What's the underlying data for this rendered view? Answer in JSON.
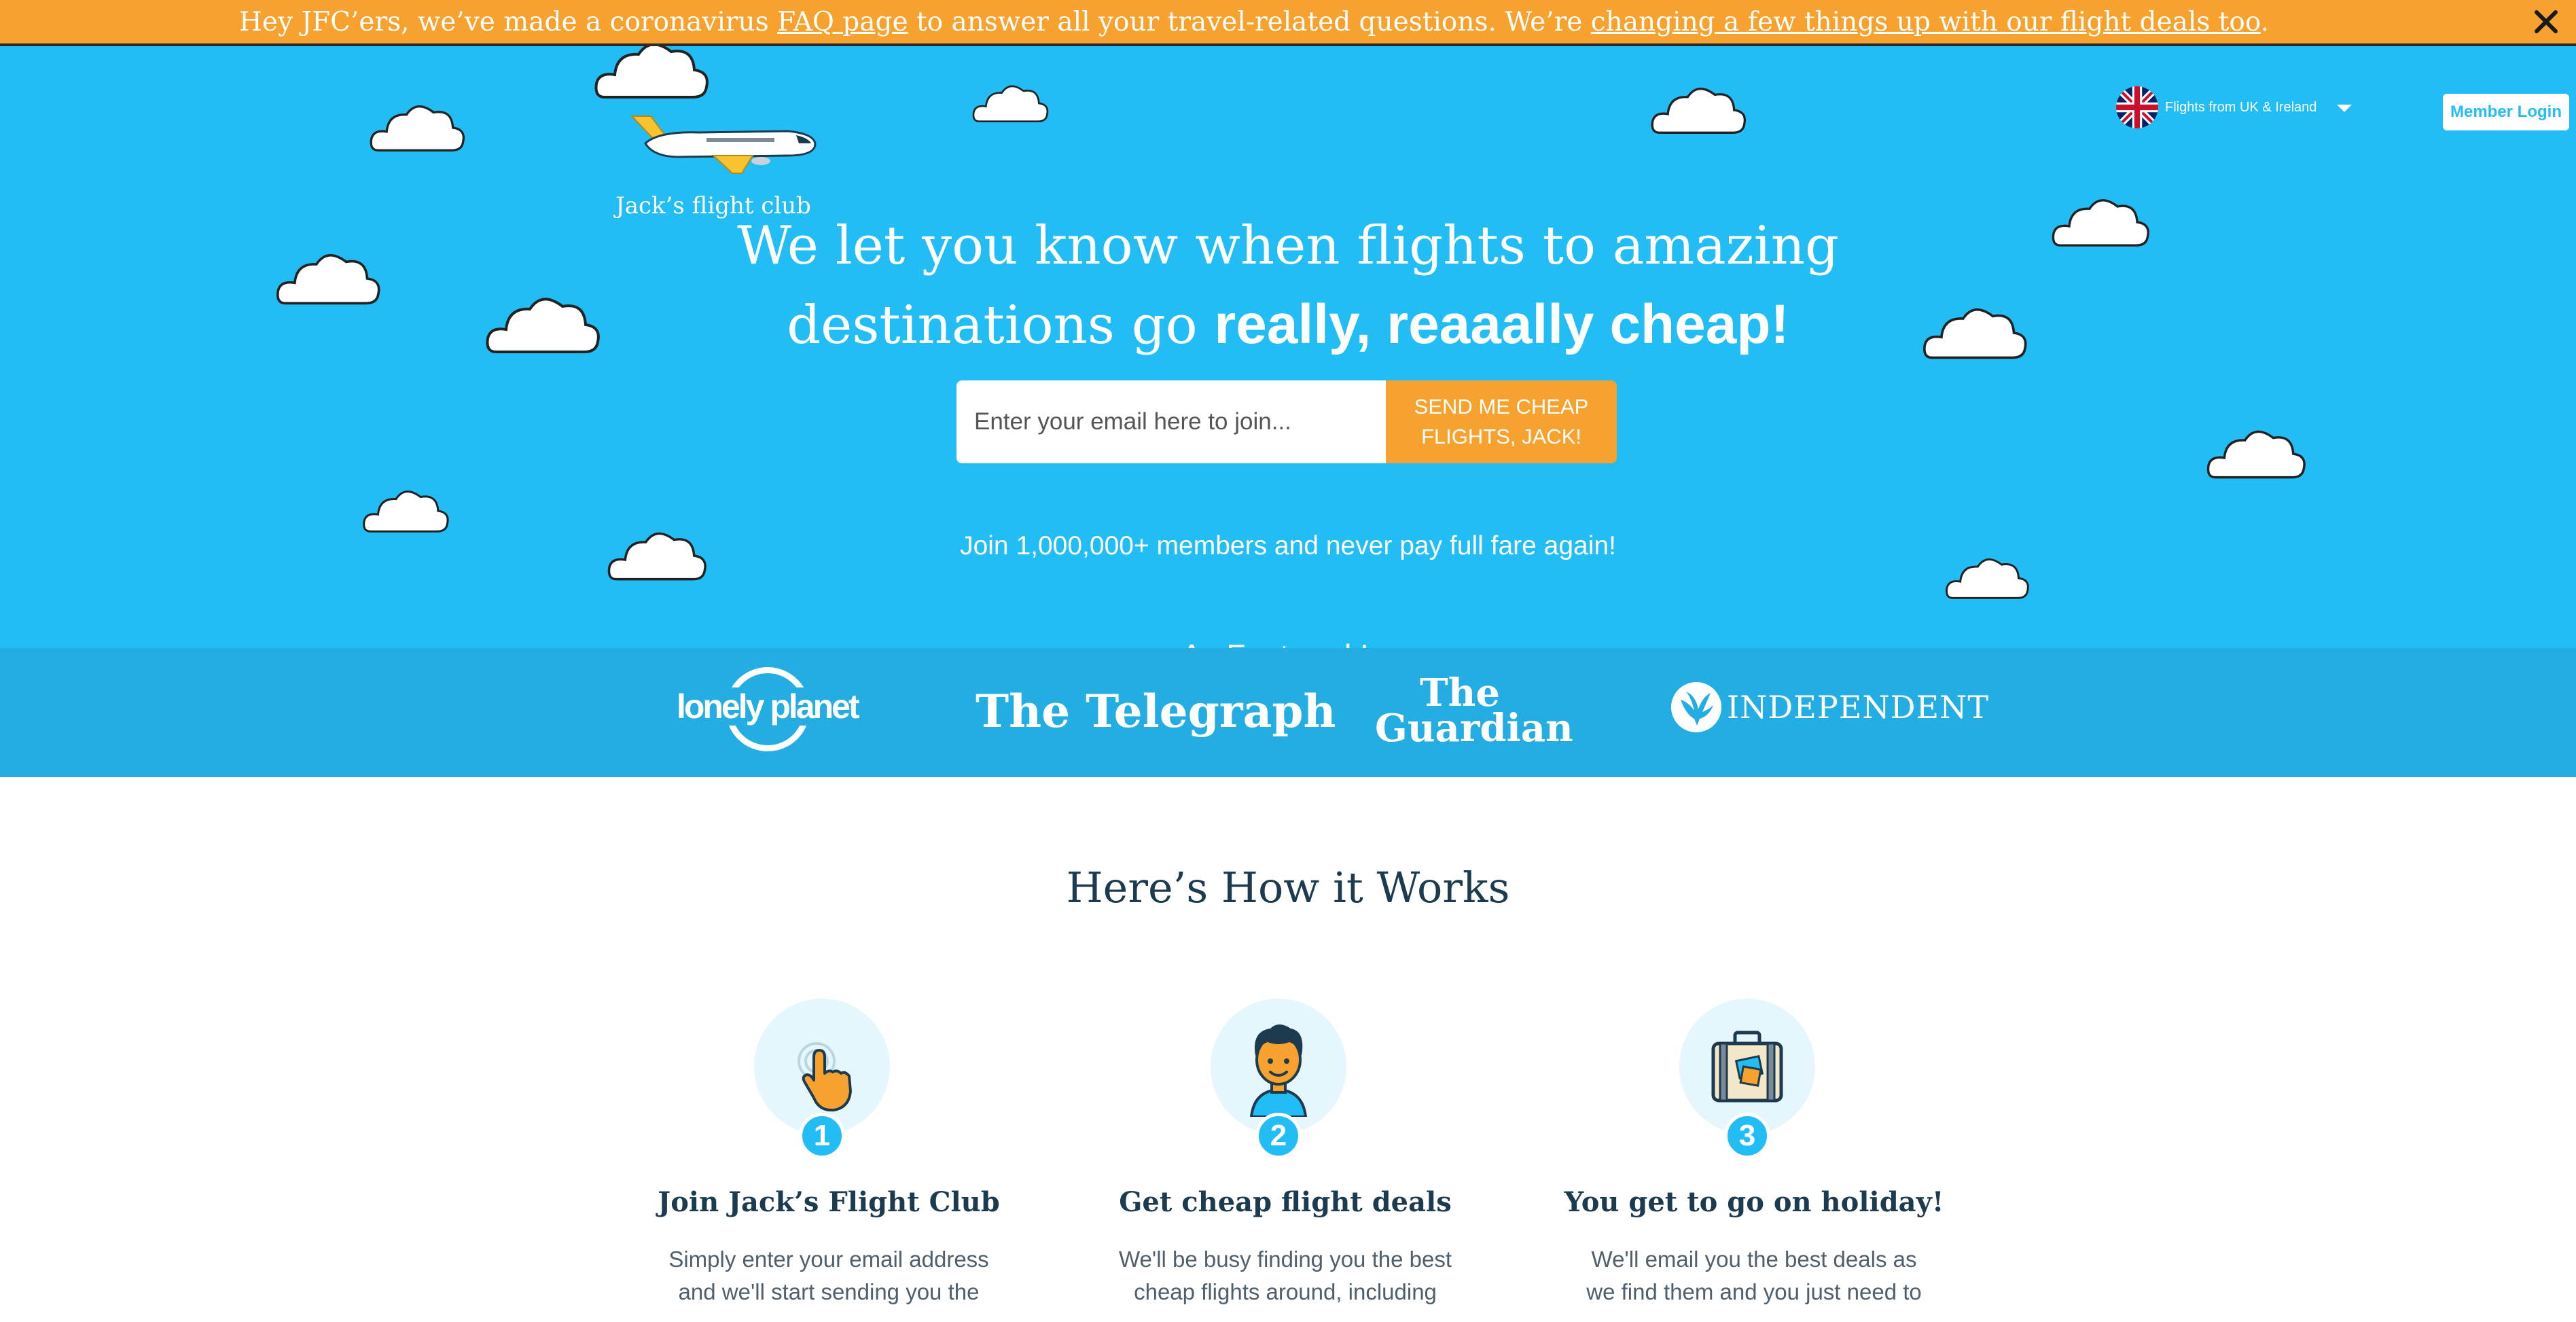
{
  "colors": {
    "banner_bg": "#f7a12f",
    "hero_bg": "#23bdf5",
    "press_bg": "#24ade3",
    "accent_orange": "#f7a12f",
    "heading_navy": "#1c3b4f"
  },
  "banner": {
    "text_1": "Hey JFC’ers, we’ve made a coronavirus ",
    "faq_link": "FAQ page",
    "text_2": " to answer all your travel-related questions. We’re ",
    "deals_link": "changing a few things up with our flight deals too",
    "text_3": ".",
    "close_icon": "close-icon"
  },
  "header": {
    "logo_text": "Jack’s flight club",
    "logo_icon": "airplane-icon",
    "region_label": "Flights from UK & Ireland",
    "region_icon": "uk-flag-icon",
    "member_login": "Member Login"
  },
  "hero": {
    "headline_line1": "We let you know when flights to amazing",
    "headline_line2_regular": "destinations go ",
    "headline_line2_bold": "really, reaaally cheap!",
    "email_placeholder": "Enter your email here to join...",
    "signup_button": "SEND ME CHEAP FLIGHTS, JACK!",
    "join_text": "Join 1,000,000+ members and never pay full fare again!",
    "featured_label": "As Featured In:"
  },
  "press": {
    "lonely_planet": "lonely planet",
    "telegraph": "The Telegraph",
    "guardian_line1": "The",
    "guardian_line2": "Guardian",
    "independent": "INDEPENDENT"
  },
  "how_it_works": {
    "title": "Here’s How it Works",
    "steps": [
      {
        "number": "1",
        "icon": "tap-hand-icon",
        "title": "Join Jack’s Flight Club",
        "desc": "Simply enter your email address and we'll start sending you the"
      },
      {
        "number": "2",
        "icon": "person-avatar-icon",
        "title": "Get cheap flight deals",
        "desc": "We'll be busy finding you the best cheap flights around, including"
      },
      {
        "number": "3",
        "icon": "suitcase-icon",
        "title": "You get to go on holiday!",
        "desc": "We'll email you the best deals as we find them and you just need to"
      }
    ]
  }
}
